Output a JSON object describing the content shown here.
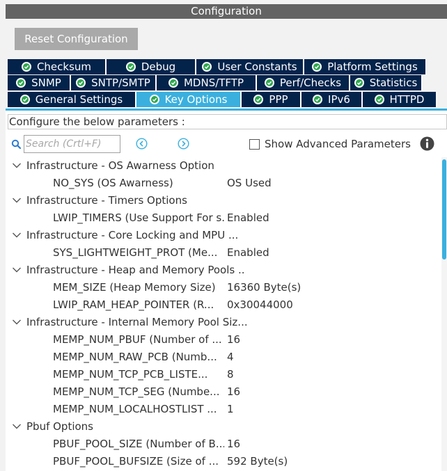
{
  "window": {
    "title": "Configuration"
  },
  "toolbar": {
    "reset_label": "Reset Configuration"
  },
  "tabs": {
    "row1": [
      "Checksum",
      "Debug",
      "User Constants",
      "Platform Settings"
    ],
    "row2": [
      "SNMP",
      "SNTP/SMTP",
      "MDNS/TFTP",
      "Perf/Checks",
      "Statistics"
    ],
    "row3": [
      "General Settings",
      "Key Options",
      "PPP",
      "IPv6",
      "HTTPD"
    ],
    "active": "Key Options"
  },
  "panel": {
    "configure_label": "Configure the below parameters :",
    "search_placeholder": "Search (Crtl+F)",
    "show_advanced_label": "Show Advanced Parameters",
    "show_advanced_checked": false
  },
  "groups": [
    {
      "label": "Infrastructure - OS Awarness Option",
      "params": [
        {
          "name": "NO_SYS (OS Awarness)",
          "value": "OS Used"
        }
      ]
    },
    {
      "label": "Infrastructure - Timers Options",
      "params": [
        {
          "name": "LWIP_TIMERS (Use Support For s...",
          "value": "Enabled"
        }
      ]
    },
    {
      "label": "Infrastructure - Core Locking and MPU ...",
      "params": [
        {
          "name": "SYS_LIGHTWEIGHT_PROT (Me...",
          "value": "Enabled"
        }
      ]
    },
    {
      "label": "Infrastructure - Heap and Memory Pools ..",
      "params": [
        {
          "name": "MEM_SIZE (Heap Memory Size)",
          "value": "16360 Byte(s)"
        },
        {
          "name": "LWIP_RAM_HEAP_POINTER (R...",
          "value": "0x30044000"
        }
      ]
    },
    {
      "label": "Infrastructure - Internal Memory Pool Siz...",
      "params": [
        {
          "name": "MEMP_NUM_PBUF (Number of ...",
          "value": "16"
        },
        {
          "name": "MEMP_NUM_RAW_PCB (Numb...",
          "value": "4"
        },
        {
          "name": "MEMP_NUM_TCP_PCB_LISTE...",
          "value": "8"
        },
        {
          "name": "MEMP_NUM_TCP_SEG (Numbe...",
          "value": "16"
        },
        {
          "name": "MEMP_NUM_LOCALHOSTLIST ...",
          "value": "1"
        }
      ]
    },
    {
      "label": "Pbuf Options",
      "params": [
        {
          "name": "PBUF_POOL_SIZE (Number of B...",
          "value": "16"
        },
        {
          "name": "PBUF_POOL_BUFSIZE (Size of ...",
          "value": "592 Byte(s)"
        }
      ]
    }
  ],
  "colors": {
    "tab_bg": "#03234b",
    "tab_active": "#3bb0de",
    "check_green": "#2fa84f",
    "title_bg": "#636363",
    "accent": "#3bb0de"
  }
}
